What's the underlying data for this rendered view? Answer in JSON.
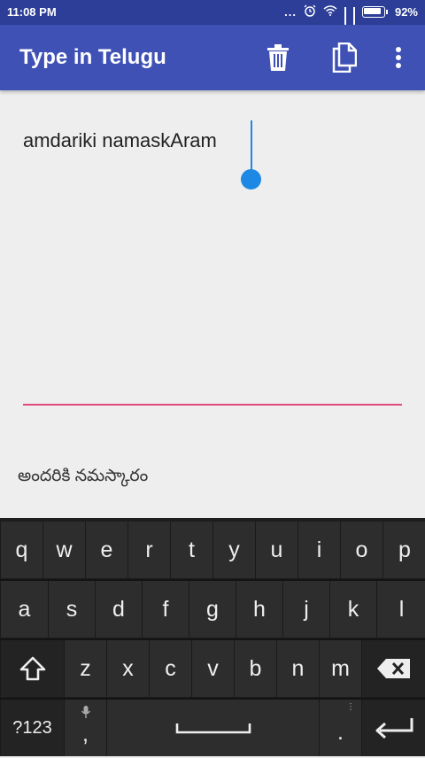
{
  "status_bar": {
    "time": "11:08 PM",
    "dots": "...",
    "battery": "92%"
  },
  "app_bar": {
    "title": "Type in Telugu"
  },
  "editor": {
    "input_text": "amdariki namaskAram"
  },
  "output": {
    "telugu_text": "అందరికి నమస్కారం"
  },
  "keyboard": {
    "row1": [
      "q",
      "w",
      "e",
      "r",
      "t",
      "y",
      "u",
      "i",
      "o",
      "p"
    ],
    "row2": [
      "a",
      "s",
      "d",
      "f",
      "g",
      "h",
      "j",
      "k",
      "l"
    ],
    "row3": [
      "z",
      "x",
      "c",
      "v",
      "b",
      "n",
      "m"
    ],
    "symbols_label": "?123",
    "comma": ",",
    "period": "."
  },
  "colors": {
    "app_bar": "#3f51b5",
    "status_bar": "#2c3e97",
    "accent": "#1e88e5",
    "underline": "#e04a7c"
  }
}
